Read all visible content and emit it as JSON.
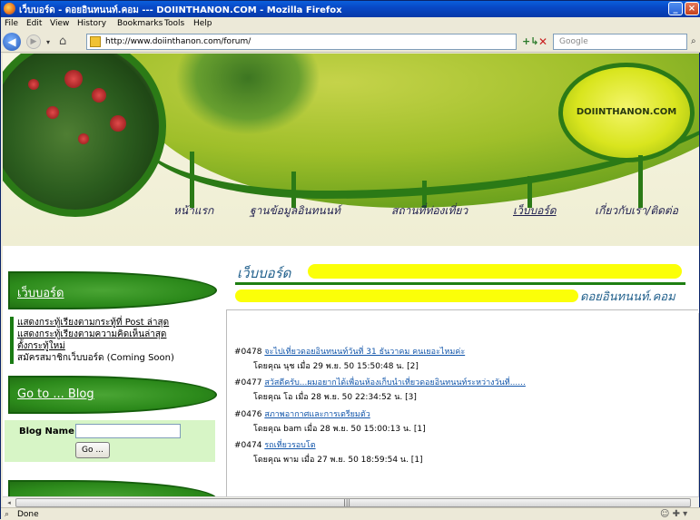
{
  "window": {
    "title": "เว็บบอร์ด - ดอยอินทนนท์.คอม --- DOIINTHANON.COM - Mozilla Firefox",
    "minimize_label": "_",
    "close_label": "×"
  },
  "menu": [
    "File",
    "Edit",
    "View",
    "History",
    "Bookmarks",
    "Tools",
    "Help"
  ],
  "nav": {
    "back_icon": "◀",
    "forward_icon": "▶",
    "dropdown_icon": "▾",
    "home_icon": "⌂",
    "url": "http://www.doiinthanon.com/forum/",
    "url_dropdown_icon": "▾",
    "go_icon": "+↳",
    "stop_icon": "✕",
    "search_placeholder": "Google",
    "search_icon": "⌕"
  },
  "banner": {
    "logo_text": "DOIINTHANON.COM",
    "nav_links": [
      "หน้าแรก",
      "ฐานข้อมูลอินทนนท์",
      "สถานที่ท่องเที่ยว",
      "เว็บบอร์ด",
      "เกี่ยวกับเรา/ติดต่อ"
    ]
  },
  "sidebar": {
    "webboard_label": "เว็บบอร์ด",
    "forum_links": [
      "แสดงกระทู้เรียงตามกระทู้ที่ Post ล่าสุด",
      "แสดงกระทู้เรียงตามความคิดเห็นล่าสุด",
      "ตั้งกระทู้ใหม่"
    ],
    "register_text": "สมัครสมาชิกเว็บบอร์ด (Coming Soon)",
    "blog_label": "Go to ... Blog",
    "blog_name_label": "Blog Name :",
    "blog_name_value": "",
    "go_button": "Go ..."
  },
  "main": {
    "title": "เว็บบอร์ด",
    "subtitle": "ดอยอินทนนท์.คอม",
    "topics": [
      {
        "num": "#0478",
        "title": "จะไปเที่ยวดอยอินทนนท์วันที่ 31 ธันวาคม คนเยอะไหมค่ะ",
        "meta": "โดยคุณ นุช เมื่อ 29 พ.ย. 50 15:50:48 น. [2]"
      },
      {
        "num": "#0477",
        "title": "สวัสดีครับ...ผมอยากได้เพื่อนห้องเก็บนำเที่ยวดอยอินทนนท์ระหว่างวันที่......",
        "meta": "โดยคุณ โอ เมื่อ 28 พ.ย. 50 22:34:52 น. [3]"
      },
      {
        "num": "#0476",
        "title": "สภาพอากาศและการเตรียมตัว",
        "meta": "โดยคุณ bam เมื่อ 28 พ.ย. 50 15:00:13 น. [1]"
      },
      {
        "num": "#0474",
        "title": "รถเที่ยวรอบโต",
        "meta": "โดยคุณ พาม เมื่อ 27 พ.ย. 50 18:59:54 น. [1]"
      }
    ]
  },
  "scrollbar": {
    "left_icon": "◂",
    "grip": "|||"
  },
  "status": {
    "icon": "⌕",
    "text": "Done",
    "right_icons": "☺ ✚ ▾"
  }
}
